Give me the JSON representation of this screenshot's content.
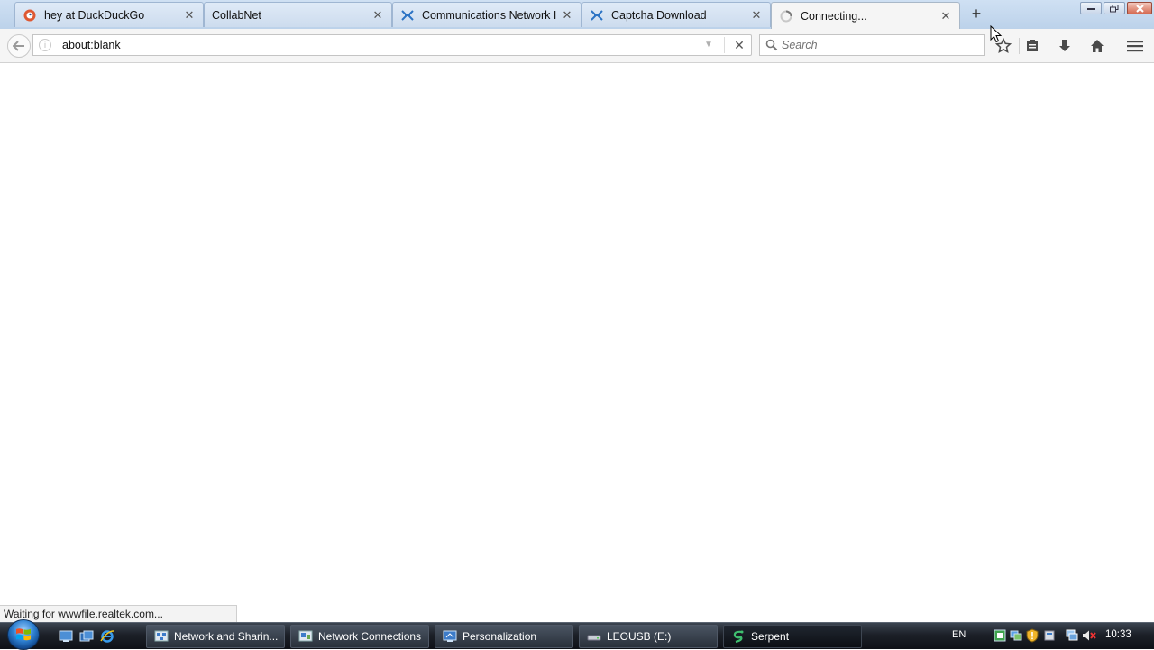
{
  "browser": {
    "tabs": [
      {
        "title": "hey at DuckDuckGo",
        "icon": "duckduckgo-icon",
        "active": false
      },
      {
        "title": "CollabNet",
        "icon": "",
        "active": false
      },
      {
        "title": "Communications Network I",
        "icon": "sourceforge-icon",
        "active": false
      },
      {
        "title": "Captcha Download",
        "icon": "sourceforge-icon",
        "active": false
      },
      {
        "title": "Connecting...",
        "icon": "loading-icon",
        "active": true
      }
    ],
    "url": "about:blank",
    "search_placeholder": "Search",
    "status_text": "Waiting for wwwfile.realtek.com..."
  },
  "taskbar": {
    "buttons": [
      {
        "label": "Network and Sharin...",
        "icon": "network-sharing-icon",
        "active": false
      },
      {
        "label": "Network Connections",
        "icon": "network-connections-icon",
        "active": false
      },
      {
        "label": "Personalization",
        "icon": "personalization-icon",
        "active": false
      },
      {
        "label": "LEOUSB (E:)",
        "icon": "usb-drive-icon",
        "active": false
      },
      {
        "label": "Serpent",
        "icon": "serpent-icon",
        "active": true
      }
    ],
    "language": "EN",
    "time": "10:33"
  }
}
